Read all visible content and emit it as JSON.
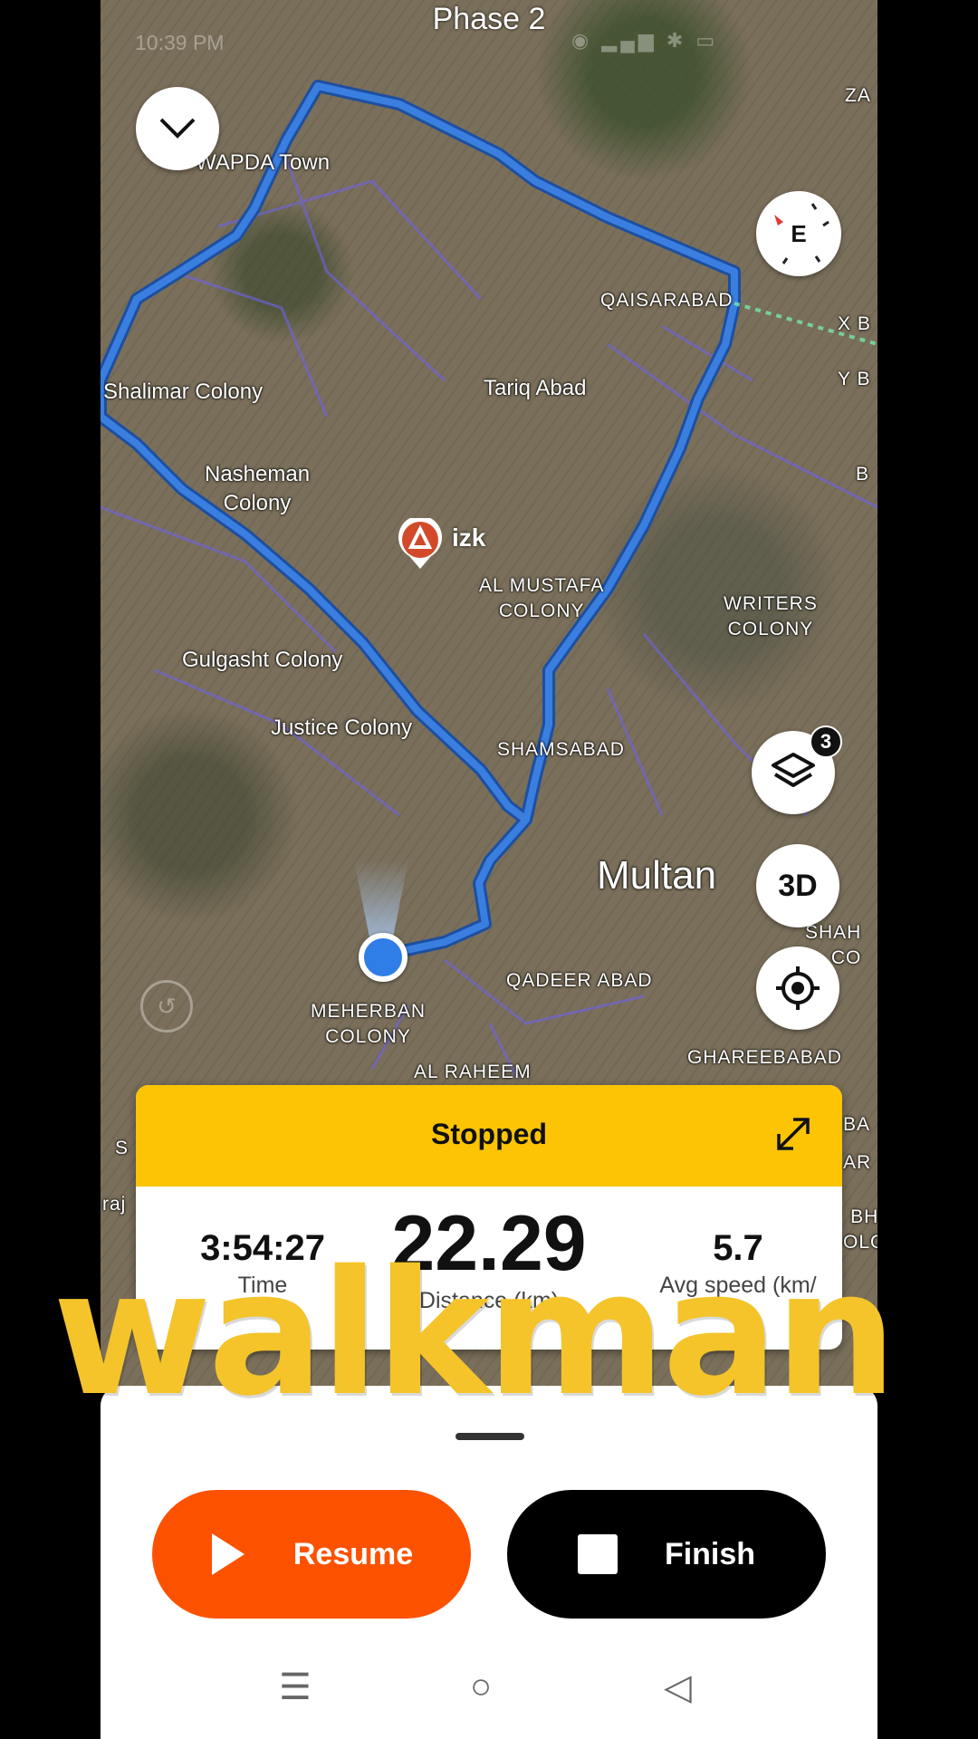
{
  "status_bar": {
    "time": "10:39 PM"
  },
  "map": {
    "title": "Phase 2",
    "labels": {
      "wapda": "WAPDA Town",
      "qaisarabad": "QAISARABAD",
      "shalimar": "Shalimar Colony",
      "tariq": "Tariq Abad",
      "nasheman": "Nasheman\nColony",
      "almustafa": "AL MUSTAFA\nCOLONY",
      "writers": "WRITERS\nCOLONY",
      "gulgasht": "Gulgasht Colony",
      "justice": "Justice Colony",
      "shamsabad": "SHAMSABAD",
      "multan": "Multan",
      "qadeer": "QADEER ABAD",
      "meherban": "MEHERBAN\nCOLONY",
      "alraheem": "AL RAHEEM",
      "ghareebabad": "GHAREEBABAD",
      "shah": "SHAH\nCO",
      "za": "ZA",
      "xb": "X B",
      "yb": "Y B",
      "b": "B",
      "ba": "BA",
      "ar": "AR",
      "bh": "BH\nOLO",
      "s": "S",
      "raj": "raj"
    },
    "poi_label": "izk",
    "compass_label": "E",
    "layers_badge": "3",
    "btn_3d": "3D"
  },
  "stats": {
    "status": "Stopped",
    "time_value": "3:54:27",
    "time_label": "Time",
    "distance_value": "22.29",
    "distance_label": "Distance (km)",
    "speed_value": "5.7",
    "speed_label": "Avg speed (km/"
  },
  "watermark": "walkman",
  "actions": {
    "resume_label": "Resume",
    "finish_label": "Finish"
  },
  "colors": {
    "status_header": "#fcc404",
    "resume": "#fc5200",
    "route": "#3a7fe0"
  }
}
